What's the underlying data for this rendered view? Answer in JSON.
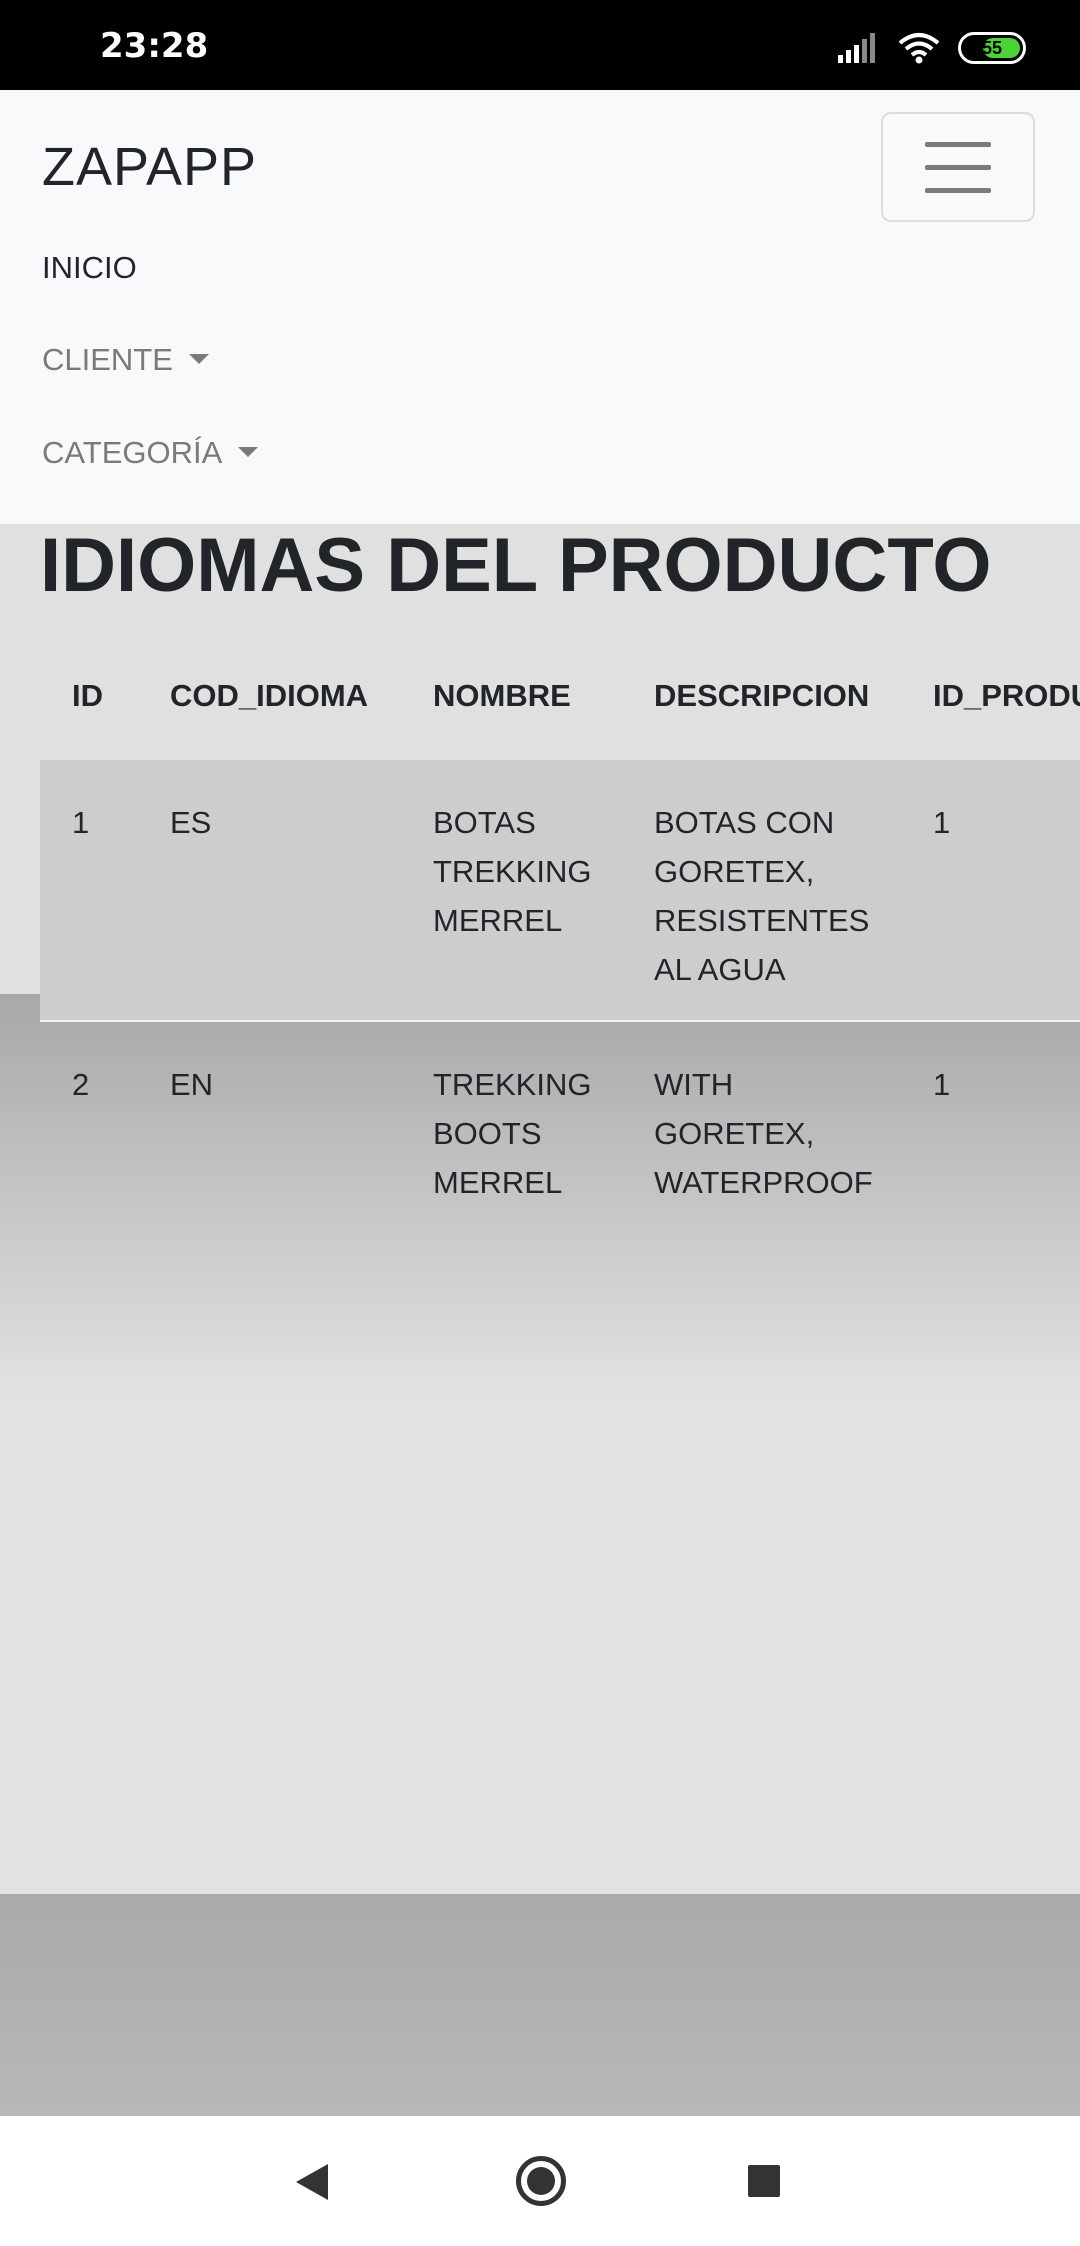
{
  "status_bar": {
    "time": "23:28",
    "battery": "55",
    "icons": [
      "signal-icon",
      "wifi-icon",
      "battery-icon"
    ]
  },
  "navbar": {
    "brand": "ZAPAPP",
    "items": [
      {
        "label": "INICIO"
      },
      {
        "label": "CLIENTE"
      },
      {
        "label": "CATEGORÍA"
      }
    ]
  },
  "page": {
    "title": "IDIOMAS DEL PRODUCTO"
  },
  "table": {
    "headers": [
      "ID",
      "COD_IDIOMA",
      "NOMBRE",
      "DESCRIPCION",
      "ID_PRODU"
    ],
    "rows": [
      {
        "id": "1",
        "cod": "ES",
        "nombre": "BOTAS TREKKING MERREL",
        "descripcion": "BOTAS CON GORETEX, RESISTENTES AL AGUA",
        "id_producto": "1"
      },
      {
        "id": "2",
        "cod": "EN",
        "nombre": "TREKKING BOOTS MERREL",
        "descripcion": "WITH GORETEX, WATERPROOF",
        "id_producto": "1"
      }
    ]
  },
  "colors": {
    "navbar_bg": "#f8f9fa",
    "page_bg": "#e2e2e2",
    "row_highlight": "#cdcdcd",
    "battery_fill": "#4cd137"
  }
}
